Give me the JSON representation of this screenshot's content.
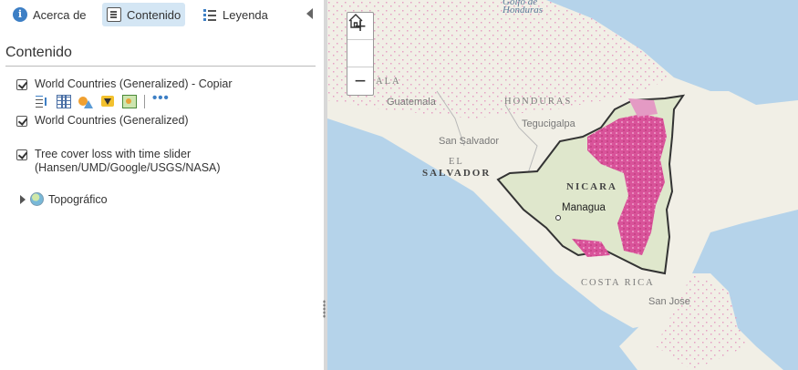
{
  "tabs": [
    {
      "label": "Acerca de",
      "icon": "info-icon"
    },
    {
      "label": "Contenido",
      "icon": "content-list-icon",
      "active": true
    },
    {
      "label": "Leyenda",
      "icon": "legend-icon"
    }
  ],
  "panel": {
    "title": "Contenido",
    "layers": [
      {
        "label": "World Countries (Generalized) - Copiar",
        "checked": true
      },
      {
        "label": "World Countries (Generalized)",
        "checked": true
      },
      {
        "label": "Tree cover loss with time slider (Hansen/UMD/Google/USGS/NASA)",
        "checked": true
      }
    ],
    "layer_tools": [
      "sort-icon",
      "attribute-table-icon",
      "change-symbology-icon",
      "filter-icon",
      "show-legend-icon",
      "more-options-icon"
    ],
    "more_label": "•••",
    "basemap": {
      "label": "Topográfico",
      "icon": "globe-icon",
      "expanded": false
    }
  },
  "map": {
    "zoom_in": "+",
    "zoom_out": "−",
    "labels": {
      "honduras_water": "Honduras",
      "golfo": "Golfo de",
      "guatemala_region": "ALA",
      "honduras_country": "HONDURAS",
      "guatemala_city": "Guatemala",
      "tegucigalpa": "Tegucigalpa",
      "san_salvador": "San Salvador",
      "el": "EL",
      "salvador": "SALVADOR",
      "nicaragua": "NICARA",
      "managua": "Managua",
      "costa_rica": "COSTA RICA",
      "san_jose": "San Jose"
    },
    "colors": {
      "water": "#b5d3ea",
      "land": "#f1efe6",
      "forest_loss": "#d9539a",
      "border": "#333333"
    }
  }
}
